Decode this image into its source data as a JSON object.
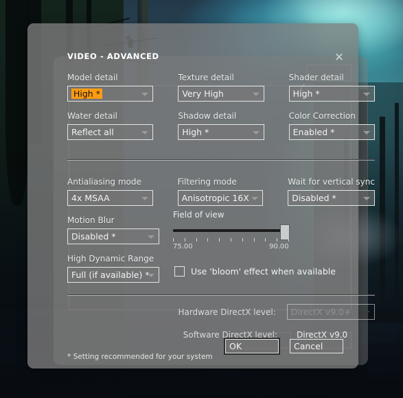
{
  "dialog": {
    "title": "VIDEO - ADVANCED",
    "close_icon": "close-icon",
    "footnote": "* Setting recommended for your system"
  },
  "settings": [
    [
      {
        "label": "Model detail",
        "value": "High *",
        "highlighted": true,
        "disabled": false
      },
      {
        "label": "Texture detail",
        "value": "Very High",
        "highlighted": false,
        "disabled": false
      },
      {
        "label": "Shader detail",
        "value": "High *",
        "highlighted": false,
        "disabled": false
      }
    ],
    [
      {
        "label": "Water detail",
        "value": "Reflect all",
        "highlighted": false,
        "disabled": false
      },
      {
        "label": "Shadow detail",
        "value": "High *",
        "highlighted": false,
        "disabled": false
      },
      {
        "label": "Color Correction",
        "value": "Enabled *",
        "highlighted": false,
        "disabled": false
      }
    ],
    [
      {
        "label": "Antialiasing mode",
        "value": "4x MSAA",
        "highlighted": false,
        "disabled": false
      },
      {
        "label": "Filtering mode",
        "value": "Anisotropic 16X",
        "highlighted": false,
        "disabled": false
      },
      {
        "label": "Wait for vertical sync",
        "value": "Disabled *",
        "highlighted": false,
        "disabled": false
      }
    ]
  ],
  "motion_blur": {
    "label": "Motion Blur",
    "value": "Disabled *"
  },
  "hdr": {
    "label": "High Dynamic Range",
    "value": "Full (if available) *"
  },
  "field_of_view": {
    "label": "Field of view",
    "min_text": "75.00",
    "max_text": "90.00",
    "min": 75.0,
    "max": 90.0,
    "value": 90.0,
    "tick_count": 11
  },
  "bloom": {
    "label": "Use 'bloom' effect when available",
    "checked": false
  },
  "directx": {
    "hardware_label": "Hardware DirectX level:",
    "hardware_value": "DirectX v9.0+",
    "hardware_disabled": true,
    "software_label": "Software DirectX level:",
    "software_value": "DirectX v9.0"
  },
  "buttons": {
    "ok": "OK",
    "cancel": "Cancel"
  },
  "colors": {
    "dialog_bg": "#7d7d7d",
    "highlight_orange": "#ff9c12",
    "text": "#ffffff",
    "border": "#e2e6e6",
    "slider_track": "#1b1b1b",
    "aurora_teal": "#6ae1e1"
  },
  "background": {
    "tick_glyph": "❮"
  }
}
